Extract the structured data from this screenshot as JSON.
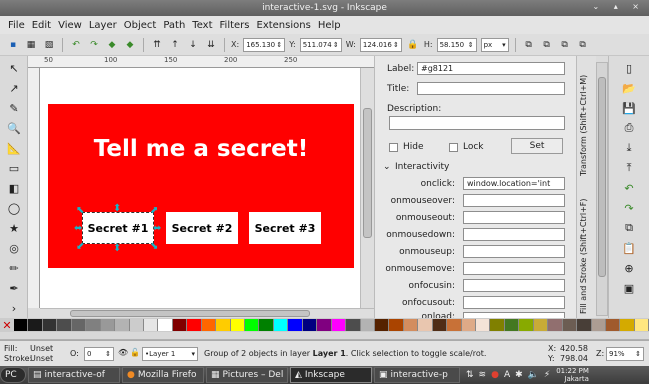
{
  "window": {
    "title": "interactive-1.svg - Inkscape",
    "controls": "⌄ ▴ ×"
  },
  "menu": [
    "File",
    "Edit",
    "View",
    "Layer",
    "Object",
    "Path",
    "Text",
    "Filters",
    "Extensions",
    "Help"
  ],
  "toolbar": {
    "x_label": "X:",
    "x_value": "165.130",
    "y_label": "Y:",
    "y_value": "511.074",
    "w_label": "W:",
    "w_value": "124.016",
    "h_label": "H:",
    "h_value": "58.150",
    "unit": "px"
  },
  "ruler_ticks": [
    "50",
    "100",
    "150",
    "200",
    "250"
  ],
  "canvas": {
    "banner_color": "#ff0000",
    "heading": "Tell me a secret!",
    "buttons": [
      "Secret #1",
      "Secret #2",
      "Secret #3"
    ]
  },
  "object_props": {
    "label_field": "Label:",
    "label_value": "#g8121",
    "title_field": "Title:",
    "description_field": "Description:",
    "hide": "Hide",
    "lock": "Lock",
    "set_button": "Set",
    "interactivity": "Interactivity",
    "events": [
      {
        "name": "onclick:",
        "value": "window.location='int"
      },
      {
        "name": "onmouseover:",
        "value": ""
      },
      {
        "name": "onmouseout:",
        "value": ""
      },
      {
        "name": "onmousedown:",
        "value": ""
      },
      {
        "name": "onmouseup:",
        "value": ""
      },
      {
        "name": "onmousemove:",
        "value": ""
      },
      {
        "name": "onfocusin:",
        "value": ""
      },
      {
        "name": "onfocusout:",
        "value": ""
      },
      {
        "name": "onload:",
        "value": ""
      }
    ]
  },
  "dock_tabs": {
    "transform": "Transform (Shift+Ctrl+M)",
    "fill_stroke": "Fill and Stroke (Shift+Ctrl+F)"
  },
  "palette": [
    "#000000",
    "#1a1a1a",
    "#333333",
    "#4d4d4d",
    "#666666",
    "#808080",
    "#999999",
    "#b3b3b3",
    "#cccccc",
    "#e6e6e6",
    "#ffffff",
    "#800000",
    "#ff0000",
    "#ff6600",
    "#ffcc00",
    "#ffff00",
    "#00ff00",
    "#008000",
    "#00ffff",
    "#0000ff",
    "#000080",
    "#800080",
    "#ff00ff",
    "#4d4d4d",
    "#b3b3b3",
    "#552200",
    "#aa4400",
    "#d38d5f",
    "#e9c6af",
    "#502d16",
    "#c87137",
    "#deaa87",
    "#f4e3d7",
    "#808000",
    "#447821",
    "#88aa00",
    "#c8ab37",
    "#916f6f",
    "#6c5d53",
    "#483e37",
    "#ac9d93",
    "#a05a2c",
    "#d4aa00",
    "#ffe680"
  ],
  "status": {
    "fill_label": "Fill:",
    "fill_value": "Unset",
    "stroke_label": "Stroke:",
    "stroke_value": "Unset",
    "opacity_label": "O:",
    "opacity_value": "0",
    "layer": "•Layer 1",
    "message_prefix": "Group of 2 objects in layer ",
    "message_layer": "Layer 1",
    "message_suffix": ". Click selection to toggle scale/rot.",
    "cursor_x_label": "X:",
    "cursor_x": "420.58",
    "cursor_y_label": "Y:",
    "cursor_y": "798.04",
    "zoom_label": "Z:",
    "zoom": "91%"
  },
  "taskbar": {
    "start": "PC",
    "tasks": [
      "interactive-of",
      "Mozilla Firefo",
      "Pictures – Del",
      "Inkscape",
      "interactive-p"
    ],
    "clock_time": "01:22 PM",
    "clock_place": "Jakarta"
  }
}
